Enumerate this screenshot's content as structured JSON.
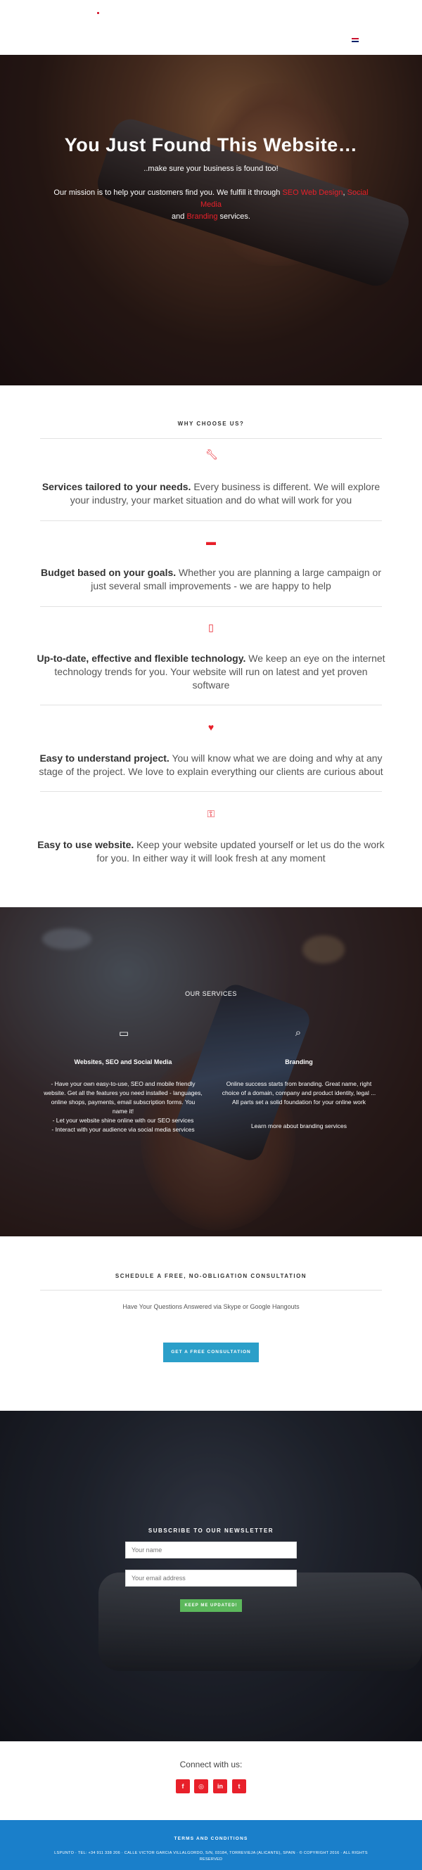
{
  "header": {
    "language_flag": "uk-flag-icon"
  },
  "hero": {
    "title": "You Just Found This Website…",
    "subtitle": "..make sure your business is found too!",
    "mission_prefix": "Our mission is to help your customers find you. We fulfill it through ",
    "link_seo": "SEO",
    "link_web_design": "Web Design",
    "sep_comma": ", ",
    "link_social_media": "Social Media",
    "and_text": "and ",
    "link_branding": "Branding",
    "services_suffix": " services."
  },
  "why": {
    "title": "WHY CHOOSE US?",
    "features": [
      {
        "icon": "wrench-icon",
        "bold": "Services tailored to your needs.",
        "text": " Every business is different. We will explore your industry, your market situation and do what will work for you"
      },
      {
        "icon": "money-icon",
        "bold": "Budget based on your goals.",
        "text": " Whether you are planning a large campaign or just several small improvements - we are happy to help"
      },
      {
        "icon": "mobile-icon",
        "bold": "Up-to-date, effective and flexible technology.",
        "text": " We keep an eye on the internet technology trends for you. Your website will run on latest and yet proven software"
      },
      {
        "icon": "heart-icon",
        "bold": "Easy to understand project.",
        "text": " You will know what we are doing and why at any stage of the project. We love to explain everything our clients are curious about"
      },
      {
        "icon": "key-icon",
        "bold": "Easy to use website.",
        "text": "  Keep your website updated yourself or let us do the work for you. In either way it will look fresh at any moment"
      }
    ]
  },
  "services": {
    "title": "OUR SERVICES",
    "col1": {
      "icon": "monitor-icon",
      "heading": "Websites, SEO and Social Media",
      "lines": [
        "- Have your own easy-to-use, SEO and mobile friendly",
        "website. Get all the features you need installed - languages,",
        "online shops, payments, email subscription forms. You",
        "name it!",
        "- Let your website shine online with our SEO services",
        "- Interact with your audience via social media services"
      ]
    },
    "col2": {
      "icon": "search-icon",
      "heading": "Branding",
      "lines": [
        "Online success starts from branding. Great name, right",
        "choice of a domain, company and product identity, legal ...",
        "All parts set a solid foundation for your online work"
      ],
      "link": "Learn more about branding services"
    }
  },
  "consultation": {
    "title": "SCHEDULE A FREE, NO-OBLIGATION CONSULTATION",
    "subtitle": "Have Your Questions Answered via Skype or Google Hangouts",
    "button": "GET A FREE CONSULTATION"
  },
  "newsletter": {
    "title": "SUBSCRIBE TO OUR NEWSLETTER",
    "name_placeholder": "Your name",
    "email_placeholder": "Your email address",
    "button": "KEEP ME UPDATED!"
  },
  "connect": {
    "title": "Connect with us:",
    "networks": [
      {
        "icon": "facebook-icon",
        "glyph": "f"
      },
      {
        "icon": "instagram-icon",
        "glyph": "◎"
      },
      {
        "icon": "linkedin-icon",
        "glyph": "in"
      },
      {
        "icon": "twitter-icon",
        "glyph": "t"
      }
    ]
  },
  "footer": {
    "title": "TERMS AND CONDITIONS",
    "address_line1": "LSPUNTO · TEL: +34 911 338 206 · CALLE VICTOR GARCIA VILLALGORDO, S/N, 03184, TORREVIEJA (ALICANTE), SPAIN · © COPYRIGHT 2016 · ALL RIGHTS",
    "address_line2": "RESERVED"
  },
  "colors": {
    "accent": "#e8202a",
    "button_blue": "#2b9fc9",
    "button_green": "#5cb85c",
    "footer_blue": "#1a7fca"
  }
}
